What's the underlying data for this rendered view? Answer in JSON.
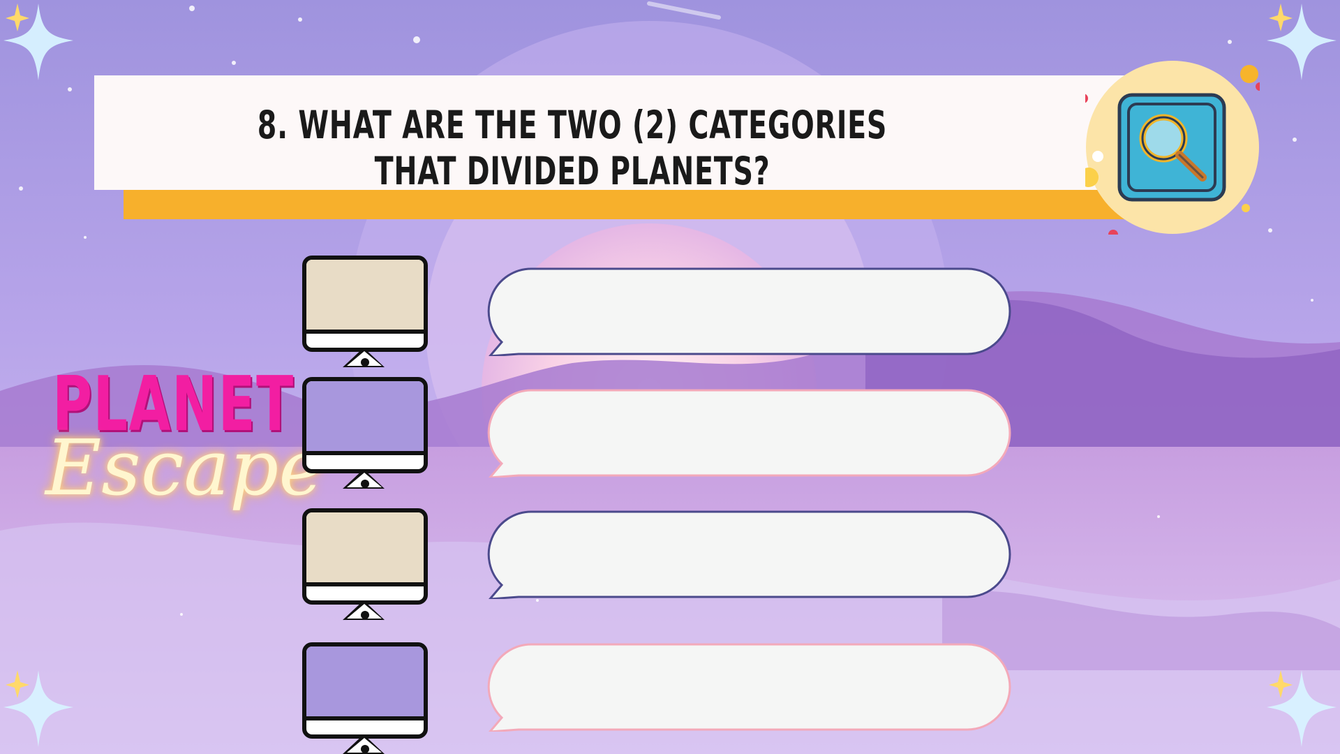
{
  "question": {
    "text": "8. What are the two (2) categories that divided planets?"
  },
  "brand": {
    "title": "PLANET",
    "script": "Escape"
  },
  "answers": [
    {
      "value": "",
      "screen_color": "#e8dcc6",
      "bubble_border": "#4b4a8c"
    },
    {
      "value": "",
      "screen_color": "#a897dd",
      "bubble_border": "#f3a9b9"
    },
    {
      "value": "",
      "screen_color": "#e8dcc6",
      "bubble_border": "#4b4a8c"
    },
    {
      "value": "",
      "screen_color": "#a897dd",
      "bubble_border": "#f3a9b9"
    }
  ],
  "icons": {
    "search": "magnifying-glass-icon",
    "sparkle": "sparkle-icon"
  },
  "colors": {
    "title_bar_accent": "#f7b02c",
    "brand_pink": "#f21ea2",
    "background_purple": "#b7a6e6"
  }
}
